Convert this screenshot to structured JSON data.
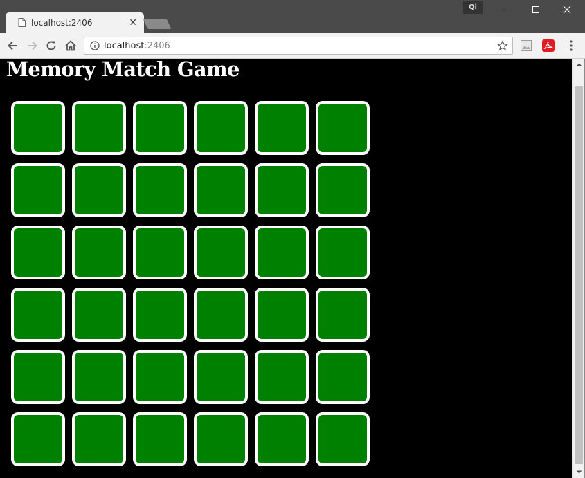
{
  "browser": {
    "tab": {
      "title": "localhost:2406",
      "icon": "document-icon"
    },
    "extension_badge": "Qi",
    "url": {
      "host": "localhost",
      "port": ":2406"
    }
  },
  "page": {
    "title": "Memory Match Game",
    "background": "#000000"
  },
  "game": {
    "rows": 6,
    "columns": 6,
    "card_color": "#008000",
    "card_border_color": "#ffffff",
    "cards_face_down": 36
  }
}
